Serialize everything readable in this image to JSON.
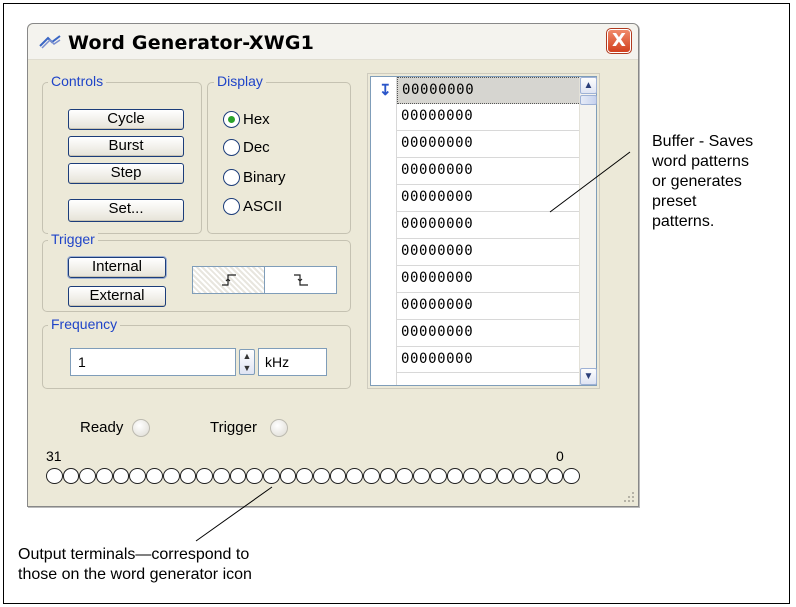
{
  "window": {
    "title": "Word Generator-XWG1",
    "close_label": "X"
  },
  "controls": {
    "label": "Controls",
    "cycle": "Cycle",
    "burst": "Burst",
    "step": "Step",
    "set": "Set..."
  },
  "display": {
    "label": "Display",
    "options": [
      {
        "label": "Hex",
        "selected": true
      },
      {
        "label": "Dec",
        "selected": false
      },
      {
        "label": "Binary",
        "selected": false
      },
      {
        "label": "ASCII",
        "selected": false
      }
    ]
  },
  "trigger": {
    "label": "Trigger",
    "internal": "Internal",
    "external": "External",
    "rising_icon": "rising-edge-icon",
    "falling_icon": "falling-edge-icon"
  },
  "frequency": {
    "label": "Frequency",
    "value": "1",
    "unit": "kHz"
  },
  "buffer": {
    "rows": [
      "00000000",
      "00000000",
      "00000000",
      "00000000",
      "00000000",
      "00000000",
      "00000000",
      "00000000",
      "00000000",
      "00000000",
      "00000000"
    ]
  },
  "status": {
    "ready": "Ready",
    "trigger": "Trigger"
  },
  "terminals": {
    "msb": "31",
    "lsb": "0",
    "count": 32
  },
  "annotations": {
    "buffer_lines": [
      "Buffer - Saves",
      "word patterns",
      "or generates",
      "preset",
      "patterns."
    ],
    "output_lines": [
      "Output terminals—correspond to",
      "those on the word generator icon"
    ]
  },
  "colors": {
    "group_label": "#1f44c8",
    "window_bg": "#ece9d8",
    "close_button": "#d2401e",
    "radio_dot": "#2aa32a"
  }
}
